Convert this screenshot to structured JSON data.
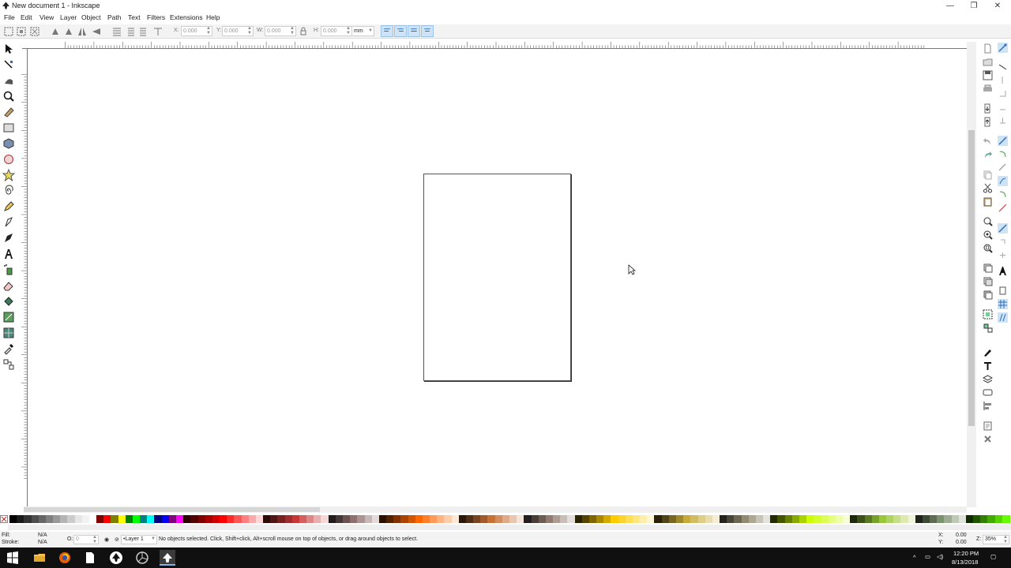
{
  "window": {
    "title": "New document 1 - Inkscape",
    "controls": [
      "—",
      "❐",
      "✕"
    ]
  },
  "menubar": [
    "File",
    "Edit",
    "View",
    "Layer",
    "Object",
    "Path",
    "Text",
    "Filters",
    "Extensions",
    "Help"
  ],
  "toolbar": {
    "x_label": "X:",
    "x_value": "0.000",
    "y_label": "Y:",
    "y_value": "0.000",
    "w_label": "W:",
    "w_value": "0.000",
    "h_label": "H:",
    "h_value": "0.000",
    "unit": "mm"
  },
  "tools": [
    "selector-tool-icon",
    "node-tool-icon",
    "tweak-tool-icon",
    "zoom-tool-icon",
    "measure-tool-icon",
    "rectangle-tool-icon",
    "3d-box-tool-icon",
    "ellipse-tool-icon",
    "star-tool-icon",
    "spiral-tool-icon",
    "pencil-tool-icon",
    "pen-tool-icon",
    "calligraphy-tool-icon",
    "text-tool-icon",
    "spray-tool-icon",
    "eraser-tool-icon",
    "paint-bucket-tool-icon",
    "gradient-tool-icon",
    "mesh-tool-icon",
    "dropper-tool-icon",
    "connector-tool-icon"
  ],
  "palette_colors": [
    "#000000",
    "#1a1a1a",
    "#333333",
    "#4d4d4d",
    "#666666",
    "#808080",
    "#999999",
    "#b3b3b3",
    "#cccccc",
    "#e6e6e6",
    "#f2f2f2",
    "#ffffff",
    "#800000",
    "#ff0000",
    "#808000",
    "#ffff00",
    "#008000",
    "#00ff00",
    "#008080",
    "#00ffff",
    "#000080",
    "#0000ff",
    "#800080",
    "#ff00ff",
    "#2b0000",
    "#550000",
    "#800000",
    "#aa0000",
    "#d40000",
    "#ff0000",
    "#ff2a2a",
    "#ff5555",
    "#ff8080",
    "#ffaaaa",
    "#ffd5d5",
    "#280b0b",
    "#501616",
    "#782121",
    "#a02c2c",
    "#c83737",
    "#d35f5f",
    "#de8787",
    "#e9afaf",
    "#f4d7d7",
    "#241c1c",
    "#483737",
    "#6c5353",
    "#916f6f",
    "#ac9393",
    "#c8b7b7",
    "#e3dbdb",
    "#2b1100",
    "#552200",
    "#803300",
    "#aa4400",
    "#d45500",
    "#ff6600",
    "#ff7f2a",
    "#ff9955",
    "#ffb380",
    "#ffccaa",
    "#ffe6d5",
    "#28170b",
    "#502d16",
    "#784421",
    "#a05a2c",
    "#c87137",
    "#d38d5f",
    "#deaa87",
    "#e9c6af",
    "#f4e3d7",
    "#241f1c",
    "#483e37",
    "#6c5d53",
    "#917c6f",
    "#ac9d93",
    "#c8beb7",
    "#e3dedb",
    "#2b2200",
    "#554400",
    "#806600",
    "#aa8800",
    "#d4aa00",
    "#ffcc00",
    "#ffd42a",
    "#ffdd55",
    "#ffe680",
    "#ffeeaa",
    "#fff6d5",
    "#28220b",
    "#504416",
    "#786721",
    "#a0892c",
    "#c8ab37",
    "#d3bc5f",
    "#decd87",
    "#e9ddaf",
    "#f4eed7",
    "#24221c",
    "#484537",
    "#6c6753",
    "#918a6f",
    "#aca793",
    "#c8c4b7",
    "#e3e2db",
    "#222b00",
    "#445500",
    "#668000",
    "#88aa00",
    "#aad400",
    "#ccff00",
    "#d4ff2a",
    "#ddff55",
    "#e5ff80",
    "#eeffaa",
    "#f6ffd5",
    "#1e280b",
    "#3c5016",
    "#5a7821",
    "#78a02c",
    "#99c837",
    "#afd35f",
    "#c6de87",
    "#dde9af",
    "#eef4d7",
    "#1e241c",
    "#3e4837",
    "#5d6c53",
    "#7c916f",
    "#9dac93",
    "#bec8b7",
    "#dee3db",
    "#112b00",
    "#225500",
    "#338000",
    "#44aa00",
    "#55d400",
    "#66ff00"
  ],
  "status": {
    "fill_label": "Fill:",
    "fill_value": "N/A",
    "stroke_label": "Stroke:",
    "stroke_value": "N/A",
    "opacity_label": "O:",
    "opacity_value": "0",
    "layer": "•Layer 1",
    "message": "No objects selected. Click, Shift+click, Alt+scroll mouse on top of objects, or drag around objects to select.",
    "cursor_x_label": "X:",
    "cursor_x": "0.00",
    "cursor_y_label": "Y:",
    "cursor_y": "0.00",
    "zoom_label": "Z:",
    "zoom": "35%"
  },
  "taskbar": {
    "time": "12:20 PM",
    "date": "8/13/2018"
  }
}
